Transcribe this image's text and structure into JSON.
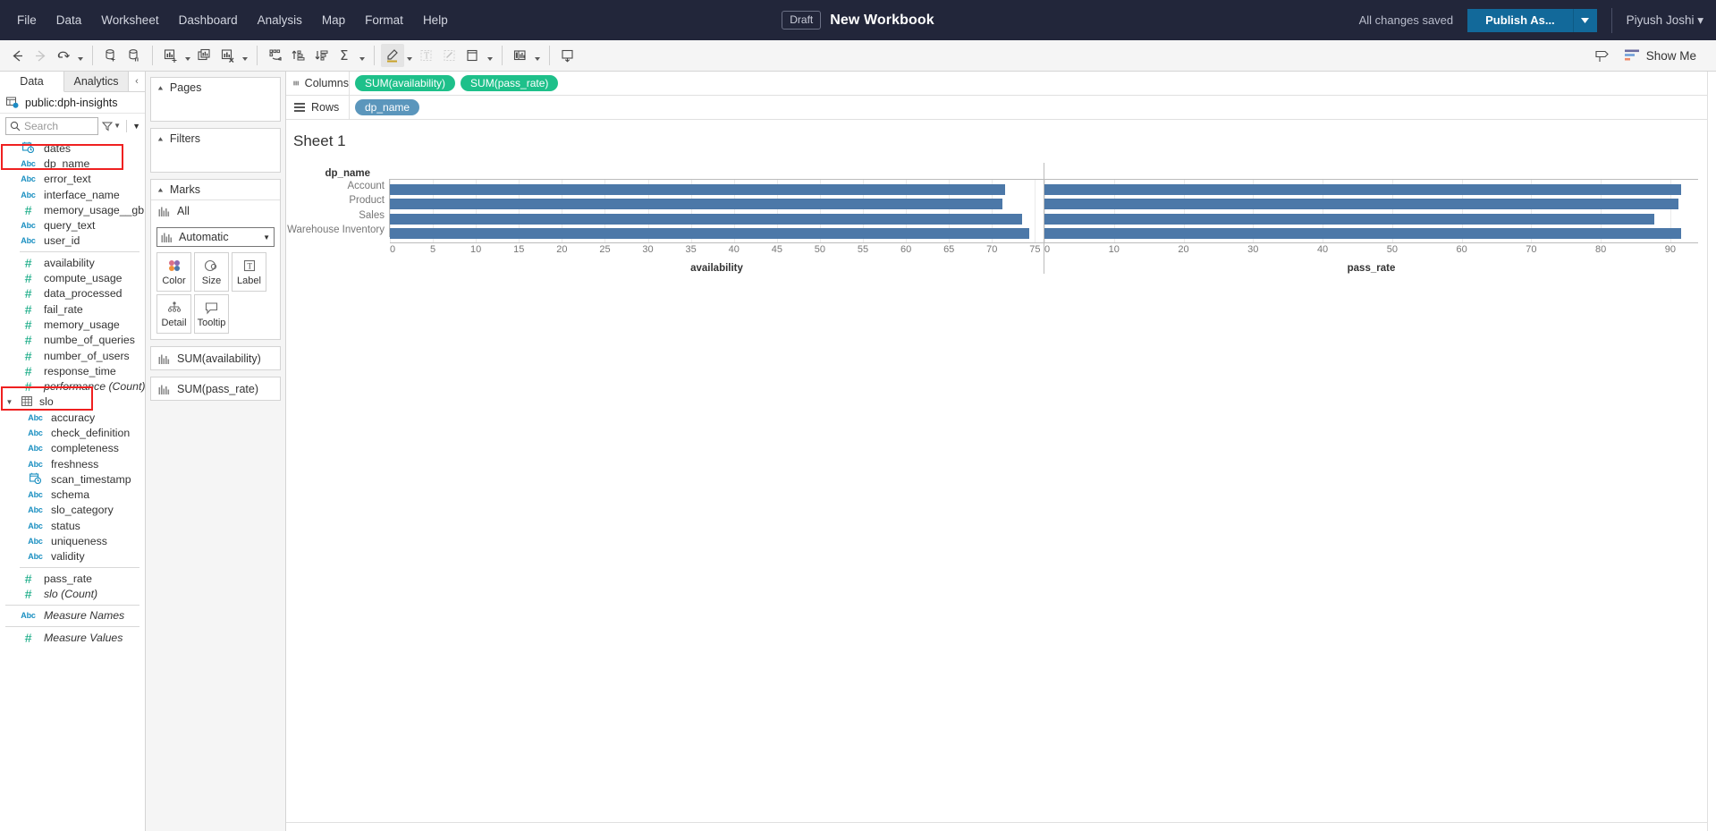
{
  "menubar": {
    "items": [
      "File",
      "Data",
      "Worksheet",
      "Dashboard",
      "Analysis",
      "Map",
      "Format",
      "Help"
    ],
    "draft_badge": "Draft",
    "workbook_title": "New Workbook",
    "save_status": "All changes saved",
    "publish_label": "Publish As...",
    "user_name": "Piyush Joshi ▾",
    "bg_color": "#22263a",
    "publish_color": "#12699a"
  },
  "toolbar": {
    "show_me_label": "Show Me",
    "icons": [
      "back-arrow-icon",
      "forward-arrow-icon",
      "undo-redo-icon",
      "redo-caret-icon",
      "new-data-source-icon",
      "pause-data-source-icon",
      "new-worksheet-icon",
      "duplicate-sheet-icon",
      "clear-sheet-icon",
      "swap-rows-columns-icon",
      "sort-ascending-icon",
      "sort-descending-icon",
      "totals-icon",
      "highlighter-icon",
      "show-labels-icon",
      "fix-axes-icon",
      "fit-selector-icon",
      "show-hide-cards-icon",
      "presentation-mode-icon"
    ]
  },
  "datapane": {
    "tabs": [
      {
        "label": "Data",
        "selected": true
      },
      {
        "label": "Analytics",
        "selected": false
      }
    ],
    "collapse_icon": "‹",
    "datasource": "public:dph-insights",
    "search_placeholder": "Search",
    "fields": [
      {
        "label": "dates",
        "type": "date",
        "indent": 1,
        "italic": false
      },
      {
        "label": "dp_name",
        "type": "abc",
        "indent": 1,
        "italic": false
      },
      {
        "label": "error_text",
        "type": "abc",
        "indent": 1,
        "italic": false
      },
      {
        "label": "interface_name",
        "type": "abc",
        "indent": 1,
        "italic": false
      },
      {
        "label": "memory_usage__gb",
        "type": "number",
        "indent": 1,
        "italic": false
      },
      {
        "label": "query_text",
        "type": "abc",
        "indent": 1,
        "italic": false
      },
      {
        "label": "user_id",
        "type": "abc",
        "indent": 1,
        "italic": false
      },
      {
        "separator": true
      },
      {
        "label": "availability",
        "type": "number",
        "indent": 1,
        "italic": false
      },
      {
        "label": "compute_usage",
        "type": "number",
        "indent": 1,
        "italic": false
      },
      {
        "label": "data_processed",
        "type": "number",
        "indent": 1,
        "italic": false
      },
      {
        "label": "fail_rate",
        "type": "number",
        "indent": 1,
        "italic": false
      },
      {
        "label": "memory_usage",
        "type": "number",
        "indent": 1,
        "italic": false
      },
      {
        "label": "numbe_of_queries",
        "type": "number",
        "indent": 1,
        "italic": false
      },
      {
        "label": "number_of_users",
        "type": "number",
        "indent": 1,
        "italic": false
      },
      {
        "label": "response_time",
        "type": "number",
        "indent": 1,
        "italic": false
      },
      {
        "label": "performance (Count)",
        "type": "number",
        "indent": 1,
        "italic": true
      },
      {
        "label": "slo",
        "type": "folder",
        "indent": 0,
        "italic": false
      },
      {
        "label": "accuracy",
        "type": "abc",
        "indent": 2,
        "italic": false
      },
      {
        "label": "check_definition",
        "type": "abc",
        "indent": 2,
        "italic": false
      },
      {
        "label": "completeness",
        "type": "abc",
        "indent": 2,
        "italic": false
      },
      {
        "label": "freshness",
        "type": "abc",
        "indent": 2,
        "italic": false
      },
      {
        "label": "scan_timestamp",
        "type": "date",
        "indent": 2,
        "italic": false
      },
      {
        "label": "schema",
        "type": "abc",
        "indent": 2,
        "italic": false
      },
      {
        "label": "slo_category",
        "type": "abc",
        "indent": 2,
        "italic": false
      },
      {
        "label": "status",
        "type": "abc",
        "indent": 2,
        "italic": false
      },
      {
        "label": "uniqueness",
        "type": "abc",
        "indent": 2,
        "italic": false
      },
      {
        "label": "validity",
        "type": "abc",
        "indent": 2,
        "italic": false
      },
      {
        "separator": true
      },
      {
        "label": "pass_rate",
        "type": "number",
        "indent": 1,
        "italic": false
      },
      {
        "label": "slo (Count)",
        "type": "number",
        "indent": 1,
        "italic": true
      },
      {
        "separator": true,
        "wide": true
      },
      {
        "label": "Measure Names",
        "type": "abc",
        "indent": 0,
        "italic": true
      },
      {
        "separator": true,
        "wide": true
      },
      {
        "label": "Measure Values",
        "type": "number",
        "indent": 0,
        "italic": true
      }
    ],
    "annotation_color": "#ef2020"
  },
  "cards": {
    "pages_label": "Pages",
    "filters_label": "Filters",
    "marks_label": "Marks",
    "marks_all_label": "All",
    "mark_type": "Automatic",
    "buttons": [
      {
        "label": "Color",
        "icon": "color-swatches-icon"
      },
      {
        "label": "Size",
        "icon": "size-circles-icon"
      },
      {
        "label": "Label",
        "icon": "label-text-icon"
      },
      {
        "label": "Detail",
        "icon": "detail-nodes-icon"
      },
      {
        "label": "Tooltip",
        "icon": "tooltip-bubble-icon"
      }
    ],
    "measure_cards": [
      "SUM(availability)",
      "SUM(pass_rate)"
    ]
  },
  "shelves": {
    "columns_label": "Columns",
    "rows_label": "Rows",
    "columns_pills": [
      "SUM(availability)",
      "SUM(pass_rate)"
    ],
    "rows_pills": [
      "dp_name"
    ],
    "pill_green": "#1ec08a",
    "pill_blue": "#5b96bc"
  },
  "sheet": {
    "title": "Sheet 1"
  },
  "chart_data": {
    "type": "bar",
    "orientation": "horizontal",
    "title": "Sheet 1",
    "row_field_label": "dp_name",
    "categories": [
      "Account",
      "Product",
      "Sales",
      "Warehouse Inventory"
    ],
    "bar_color": "#4c78a8",
    "grid": true,
    "legend": "none",
    "panes": [
      {
        "name": "availability",
        "xlabel": "availability",
        "values": [
          71.5,
          71.2,
          73.5,
          74.3
        ],
        "xlim": [
          0,
          76
        ],
        "ticks": [
          0,
          5,
          10,
          15,
          20,
          25,
          30,
          35,
          40,
          45,
          50,
          55,
          60,
          65,
          70,
          75
        ]
      },
      {
        "name": "pass_rate",
        "xlabel": "pass_rate",
        "values": [
          91.5,
          91.2,
          87.7,
          91.5
        ],
        "xlim": [
          0,
          94
        ],
        "ticks": [
          0,
          10,
          20,
          30,
          40,
          50,
          60,
          70,
          80,
          90
        ]
      }
    ]
  }
}
